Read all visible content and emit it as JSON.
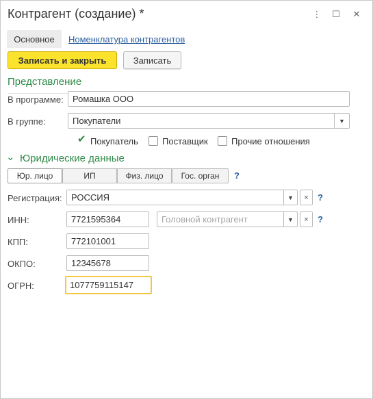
{
  "window": {
    "title": "Контрагент (создание) *",
    "controls": {
      "menu": "⋮",
      "maximize": "☐",
      "close": "✕"
    }
  },
  "tabs": {
    "main": "Основное",
    "nomenclature": "Номенклатура контрагентов"
  },
  "toolbar": {
    "save_close": "Записать и закрыть",
    "save": "Записать"
  },
  "presentation": {
    "heading": "Представление",
    "in_program_label": "В программе:",
    "in_program_value": "Ромашка ООО",
    "in_group_label": "В группе:",
    "in_group_value": "Покупатели"
  },
  "relations": {
    "buyer": {
      "label": "Покупатель",
      "checked": true
    },
    "supplier": {
      "label": "Поставщик",
      "checked": false
    },
    "other": {
      "label": "Прочие отношения",
      "checked": false
    }
  },
  "legal": {
    "heading": "Юридические данные",
    "types": [
      "Юр. лицо",
      "ИП",
      "Физ. лицо",
      "Гос. орган"
    ],
    "selected_type": "Юр. лицо",
    "help": "?"
  },
  "fields": {
    "registration_label": "Регистрация:",
    "registration_value": "РОССИЯ",
    "inn_label": "ИНН:",
    "inn_value": "7721595364",
    "head_placeholder": "Головной контрагент",
    "kpp_label": "КПП:",
    "kpp_value": "772101001",
    "okpo_label": "ОКПО:",
    "okpo_value": "12345678",
    "ogrn_label": "ОГРН:",
    "ogrn_value": "1077759115147"
  },
  "icons": {
    "dropdown": "▼",
    "clear": "×",
    "check": "✔",
    "chevron": "⌄"
  },
  "colors": {
    "accent_green": "#2e8a48",
    "primary_button": "#fbe32d",
    "link": "#2a5d9e",
    "focus": "#f5c642"
  }
}
